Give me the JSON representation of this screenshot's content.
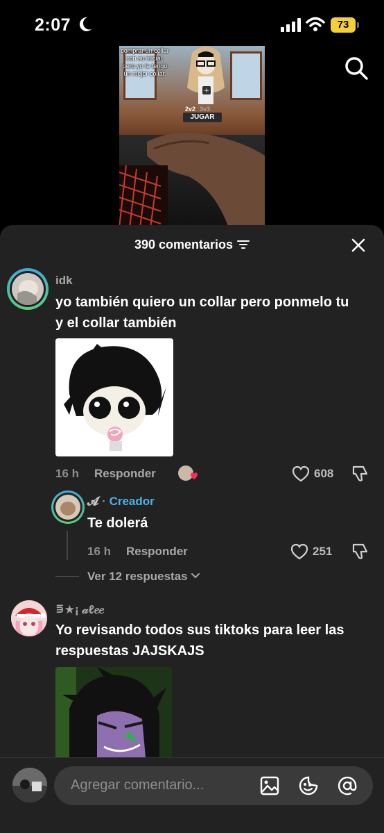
{
  "status_bar": {
    "time": "2:07",
    "battery": "73"
  },
  "video": {
    "caption": "comprar un collar con su inicial, pero yo le tengo un mejor collar.",
    "mode_2v2": "2v2",
    "mode_3v3": "3v3",
    "play_button": "JUGAR"
  },
  "comments_panel": {
    "count_label": "390 comentarios"
  },
  "comments": [
    {
      "username": "idk",
      "text": "yo también quiero un collar pero ponmelo tu y el collar también",
      "time": "16 h",
      "reply_label": "Responder",
      "likes": "608"
    },
    {
      "username": "𝓐",
      "creator_label": "Creador",
      "separator": "·",
      "text": "Te dolerá",
      "time": "16 h",
      "reply_label": "Responder",
      "likes": "251"
    },
    {
      "username": "⋾★¡ 𝒶ℓ𝑒𝑒",
      "text": "Yo revisando todos sus tiktoks para leer las respuestas JAJSKAJS"
    }
  ],
  "view_replies": "Ver 12 respuestas",
  "composer": {
    "placeholder": "Agregar comentario..."
  },
  "colors": {
    "panel_bg": "#222222",
    "creator_blue": "#4cb3e8",
    "battery_yellow": "#f5cf3a"
  },
  "icons": [
    "moon-icon",
    "signal-icon",
    "wifi-icon",
    "search-icon",
    "filter-icon",
    "close-icon",
    "heart-icon",
    "dislike-icon",
    "image-icon",
    "emoji-icon",
    "mention-icon"
  ]
}
